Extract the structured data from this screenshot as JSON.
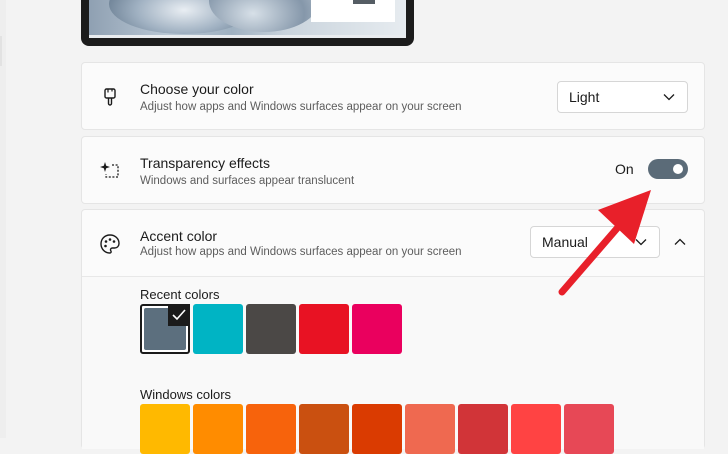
{
  "choose_color": {
    "title": "Choose your color",
    "subtitle": "Adjust how apps and Windows surfaces appear on your screen",
    "dropdown_value": "Light"
  },
  "transparency": {
    "title": "Transparency effects",
    "subtitle": "Windows and surfaces appear translucent",
    "state_label": "On",
    "toggle_on": true
  },
  "accent": {
    "title": "Accent color",
    "subtitle": "Adjust how apps and Windows surfaces appear on your screen",
    "dropdown_value": "Manual",
    "expanded": true
  },
  "recent_colors": {
    "label": "Recent colors",
    "colors": [
      "#5c6f7e",
      "#00b4c4",
      "#4b4846",
      "#e81223",
      "#ea005e"
    ],
    "selected_index": 0
  },
  "windows_colors": {
    "label": "Windows colors",
    "colors": [
      "#ffb900",
      "#ff8c00",
      "#f7630c",
      "#ca5010",
      "#da3b01",
      "#ef6950",
      "#d13438",
      "#ff4343",
      "#e74856"
    ]
  },
  "icons": {
    "choose_color": "paintbrush-icon",
    "transparency": "sparkle-selection-icon",
    "accent": "palette-icon"
  },
  "annotation": {
    "arrow_color": "#e8202a"
  }
}
